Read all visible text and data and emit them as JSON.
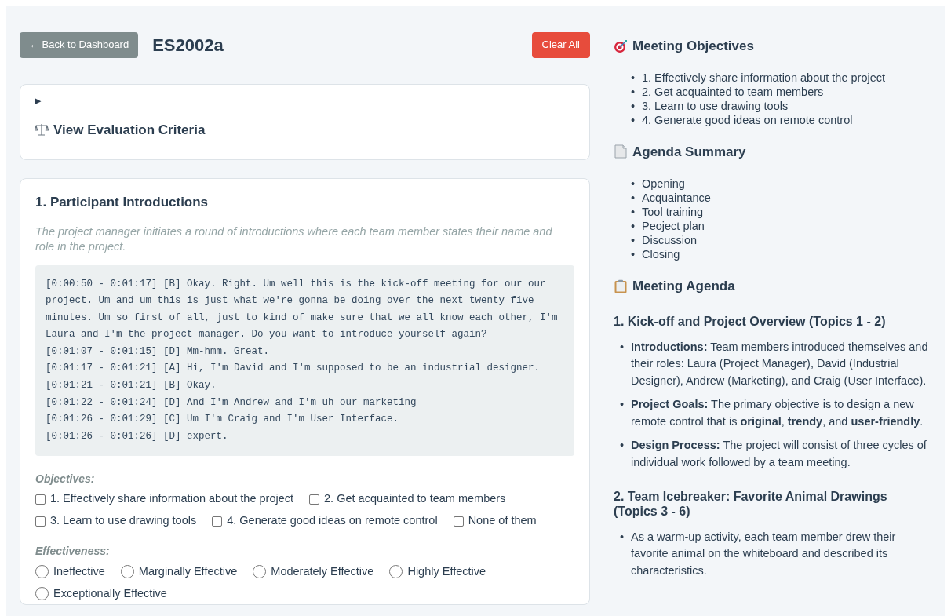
{
  "header": {
    "back_button": "← Back to Dashboard",
    "title": "ES2002a",
    "clear_button": "Clear All"
  },
  "criteria": {
    "expanded": false,
    "marker": "▶",
    "title": "View Evaluation Criteria"
  },
  "section": {
    "title": "1. Participant Introductions",
    "description": "The project manager initiates a round of introductions where each team member states their name and role in the project.",
    "transcript": [
      "[0:00:50 - 0:01:17] [B] Okay. Right. Um well this is the kick-off meeting for our our project. Um and um this is just what we're gonna be doing over the next twenty five minutes. Um so first of all, just to kind of make sure that we all know each other, I'm Laura and I'm the project manager. Do you want to introduce yourself again?",
      "[0:01:07 - 0:01:15] [D] Mm-hmm. Great.",
      "[0:01:17 - 0:01:21] [A] Hi, I'm David and I'm supposed to be an industrial designer.",
      "[0:01:21 - 0:01:21] [B] Okay.",
      "[0:01:22 - 0:01:24] [D] And I'm Andrew and I'm uh our marketing",
      "[0:01:26 - 0:01:29] [C] Um I'm Craig and I'm User Interface.",
      "[0:01:26 - 0:01:26] [D] expert."
    ],
    "objectives_label": "Objectives:",
    "objectives": [
      {
        "label": "1. Effectively share information about the project",
        "checked": false
      },
      {
        "label": "2. Get acquainted to team members",
        "checked": false
      },
      {
        "label": "3. Learn to use drawing tools",
        "checked": false
      },
      {
        "label": "4. Generate good ideas on remote control",
        "checked": false
      },
      {
        "label": "None of them",
        "checked": false
      }
    ],
    "effectiveness_label": "Effectiveness:",
    "effectiveness": [
      {
        "label": "Ineffective",
        "selected": false
      },
      {
        "label": "Marginally Effective",
        "selected": false
      },
      {
        "label": "Moderately Effective",
        "selected": false
      },
      {
        "label": "Highly Effective",
        "selected": false
      },
      {
        "label": "Exceptionally Effective",
        "selected": false
      }
    ]
  },
  "sidebar": {
    "bullet": "•",
    "objectives": {
      "title": "Meeting Objectives",
      "items": [
        "1. Effectively share information about the project",
        "2. Get acquainted to team members",
        "3. Learn to use drawing tools",
        "4. Generate good ideas on remote control"
      ]
    },
    "summary": {
      "title": "Agenda Summary",
      "items": [
        "Opening",
        "Acquaintance",
        "Tool training",
        "Peoject plan",
        "Discussion",
        "Closing"
      ]
    },
    "agenda": {
      "title": "Meeting Agenda",
      "sections": [
        {
          "title": "1. Kick-off and Project Overview (Topics 1 - 2)",
          "items": [
            "**Introductions:** Team members introduced themselves and their roles: Laura (Project Manager), David (Industrial Designer), Andrew (Marketing), and Craig (User Interface).",
            "**Project Goals:** The primary objective is to design a new remote control that is **original**, **trendy**, and **user-friendly**.",
            "**Design Process:** The project will consist of three cycles of individual work followed by a team meeting."
          ]
        },
        {
          "title": "2. Team Icebreaker: Favorite Animal Drawings (Topics 3 - 6)",
          "items": [
            "As a warm-up activity, each team member drew their favorite animal on the whiteboard and described its characteristics."
          ]
        }
      ]
    }
  }
}
